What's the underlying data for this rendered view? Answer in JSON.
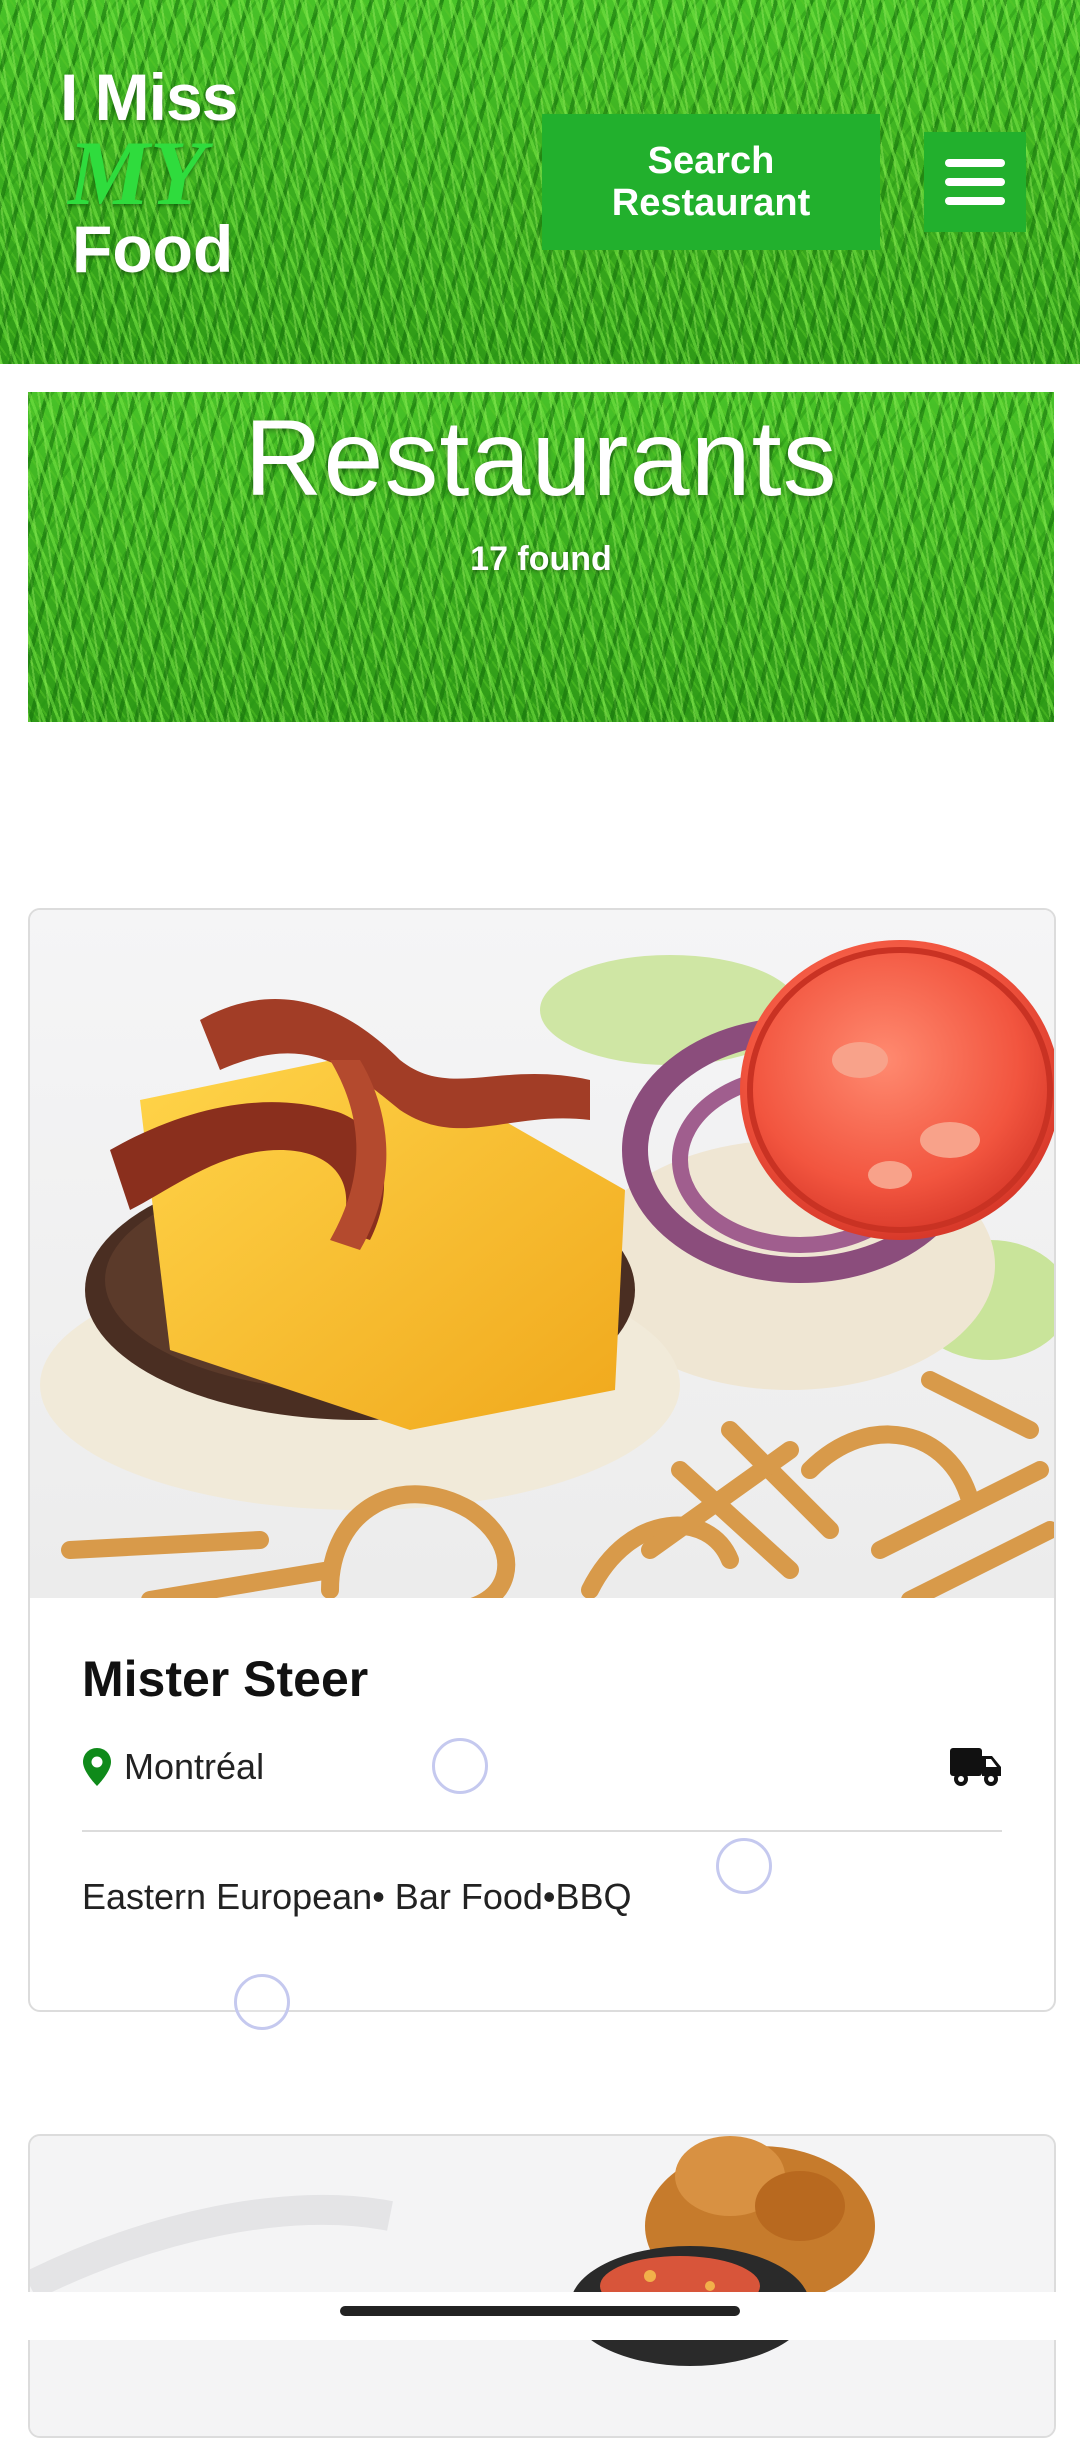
{
  "header": {
    "logo": {
      "line1": "I Miss",
      "line2": "MY",
      "line3": "Food"
    },
    "search_button": "Search Restaurant",
    "menu_icon": "hamburger-menu-icon"
  },
  "banner": {
    "title": "Restaurants",
    "count_text": "17 found"
  },
  "restaurants": [
    {
      "name": "Mister Steer",
      "location": "Montréal",
      "location_icon": "map-pin-icon",
      "delivery_icon": "delivery-truck-icon",
      "cuisines": "Eastern European• Bar Food•BBQ",
      "image": "burger-photo"
    },
    {
      "image": "food-photo"
    }
  ],
  "colors": {
    "brand_green": "#22b02d",
    "logo_accent": "#2fdc3d",
    "pin_green": "#0f8a1a"
  }
}
